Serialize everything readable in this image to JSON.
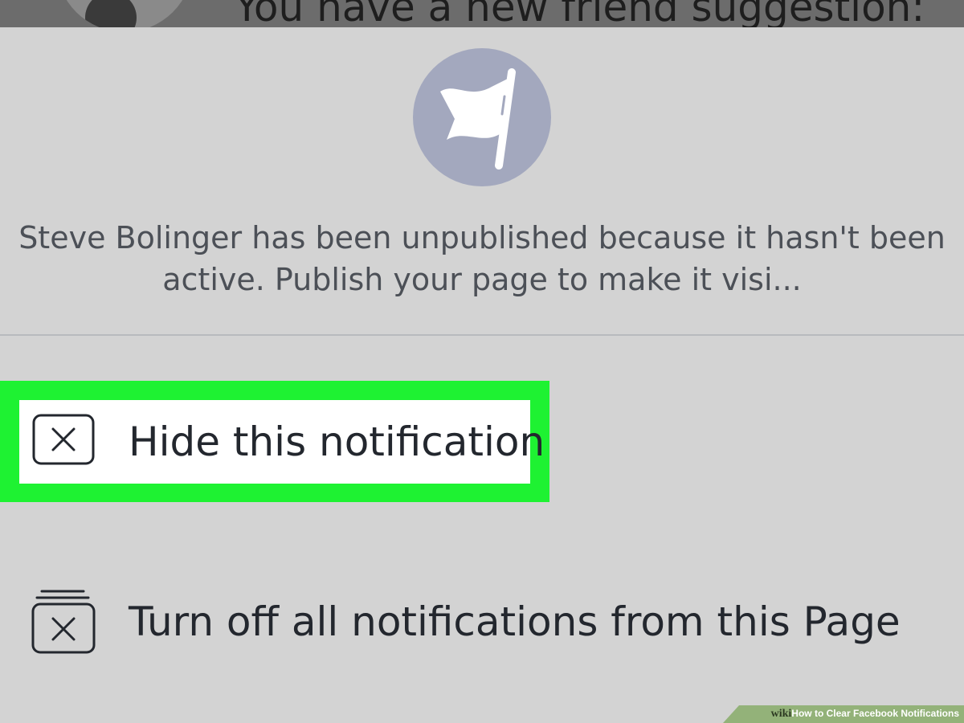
{
  "top_notification": {
    "text": "You have a new friend suggestion:"
  },
  "sheet": {
    "page_icon": "flag-icon",
    "message": "Steve Bolinger has been unpublished because it hasn't been active. Publish your page to make it visi...",
    "options": [
      {
        "icon": "close-box-icon",
        "label": "Hide this notification"
      },
      {
        "icon": "stacked-close-box-icon",
        "label": "Turn off all notifications from this Page"
      }
    ]
  },
  "watermark": {
    "logo": "wiki",
    "title": "How to Clear Facebook Notifications"
  },
  "colors": {
    "background": "#d3d3d3",
    "highlight": "#1ef232",
    "icon_circle": "#a3a8be",
    "text": "#23272e"
  }
}
